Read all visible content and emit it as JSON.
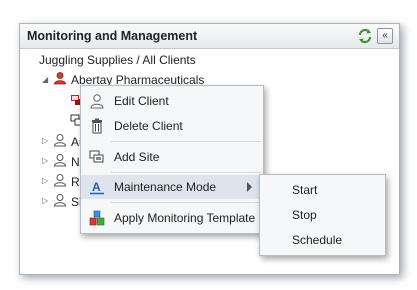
{
  "panel": {
    "title": "Monitoring and Management",
    "refresh_icon": "refresh-icon",
    "collapse_icon": "double-chevron-left-icon",
    "collapse_glyph": "«"
  },
  "tree": {
    "root_label": "Juggling Supplies / All Clients",
    "clients": [
      {
        "label": "Abertay Pharmaceuticals",
        "expanded": true,
        "icon": "user-red-icon"
      },
      {
        "label": "Au",
        "expanded": false,
        "icon": "user-icon"
      },
      {
        "label": "Ne",
        "expanded": false,
        "icon": "user-icon"
      },
      {
        "label": "Ro",
        "expanded": false,
        "icon": "user-icon"
      },
      {
        "label": "Si",
        "expanded": false,
        "icon": "user-icon"
      }
    ],
    "site_icons": [
      "site-red-icon",
      "site-icon"
    ]
  },
  "context_menu": {
    "items": [
      {
        "label": "Edit Client",
        "icon": "user-outline-icon"
      },
      {
        "label": "Delete Client",
        "icon": "trash-icon"
      },
      {
        "label": "Add Site",
        "icon": "add-site-icon"
      },
      {
        "label": "Maintenance Mode",
        "icon": "maintenance-a-icon",
        "has_submenu": true
      },
      {
        "label": "Apply Monitoring Template",
        "icon": "template-blocks-icon"
      }
    ]
  },
  "submenu": {
    "items": [
      {
        "label": "Start"
      },
      {
        "label": "Stop"
      },
      {
        "label": "Schedule"
      }
    ]
  },
  "colors": {
    "accent_red": "#c0222a",
    "menu_hover": "#dde4ec",
    "refresh_green": "#3a9a2c"
  }
}
